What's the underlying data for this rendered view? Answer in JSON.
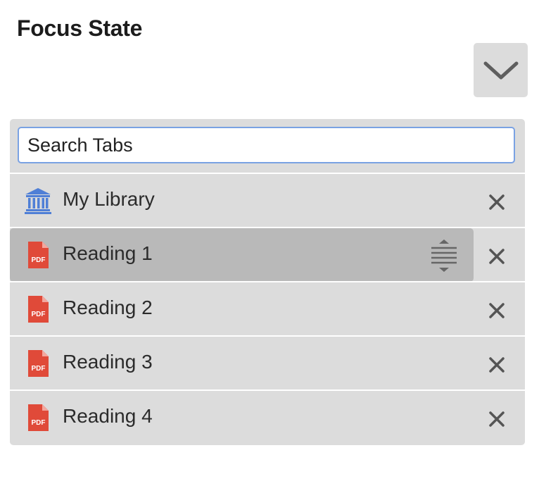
{
  "header": {
    "title": "Focus State",
    "toggle_icon": "chevron-down-icon"
  },
  "search": {
    "placeholder": "Search Tabs",
    "value": ""
  },
  "tabs": [
    {
      "label": "My Library",
      "icon": "library-icon",
      "active": false
    },
    {
      "label": "Reading 1",
      "icon": "pdf-icon",
      "active": true
    },
    {
      "label": "Reading 2",
      "icon": "pdf-icon",
      "active": false
    },
    {
      "label": "Reading 3",
      "icon": "pdf-icon",
      "active": false
    },
    {
      "label": "Reading 4",
      "icon": "pdf-icon",
      "active": false
    }
  ],
  "icons": {
    "pdf_text": "PDF"
  },
  "colors": {
    "panel_bg": "#dcdcdc",
    "active_tab_bg": "#b9b9b9",
    "focus_border": "#7aa2e3",
    "library_icon": "#4f7fd6",
    "pdf_icon": "#e04a39",
    "close_icon": "#555555"
  }
}
